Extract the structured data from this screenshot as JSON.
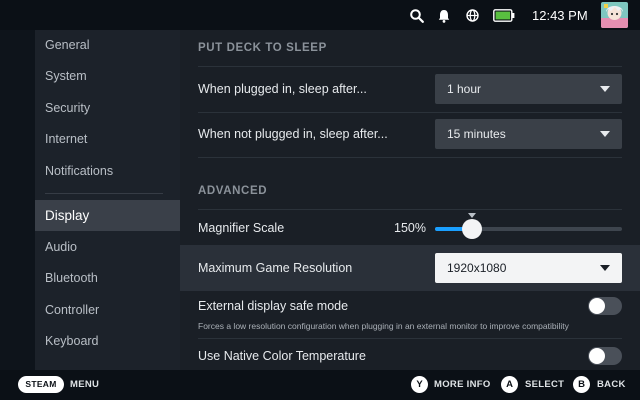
{
  "status_bar": {
    "time": "12:43 PM",
    "icons": [
      "search-icon",
      "notification-bell-icon",
      "globe-icon",
      "battery-charging-icon",
      "avatar"
    ]
  },
  "sidebar": {
    "items": [
      {
        "label": "General"
      },
      {
        "label": "System"
      },
      {
        "label": "Security"
      },
      {
        "label": "Internet"
      },
      {
        "label": "Notifications"
      },
      {
        "label": "Display",
        "active": true
      },
      {
        "label": "Audio"
      },
      {
        "label": "Bluetooth"
      },
      {
        "label": "Controller"
      },
      {
        "label": "Keyboard"
      }
    ]
  },
  "sleep": {
    "title": "PUT DECK TO SLEEP",
    "plugged_label": "When plugged in, sleep after...",
    "plugged_value": "1 hour",
    "unplugged_label": "When not plugged in, sleep after...",
    "unplugged_value": "15 minutes"
  },
  "advanced": {
    "title": "ADVANCED",
    "magnifier_label": "Magnifier Scale",
    "magnifier_value": "150%",
    "magnifier_level": 0.2,
    "resolution_label": "Maximum Game Resolution",
    "resolution_value": "1920x1080",
    "safe_mode_label": "External display safe mode",
    "safe_mode_desc": "Forces a low resolution configuration when plugging in an external monitor to improve compatibility",
    "safe_mode_on": false,
    "color_temp_label": "Use Native Color Temperature",
    "color_temp_on": false
  },
  "footer": {
    "steam": "STEAM",
    "menu": "MENU",
    "y_key": "Y",
    "more_info": "MORE INFO",
    "a_key": "A",
    "select": "SELECT",
    "b_key": "B",
    "back": "BACK"
  },
  "colors": {
    "accent": "#1a9fff",
    "battery": "#59bf40"
  }
}
